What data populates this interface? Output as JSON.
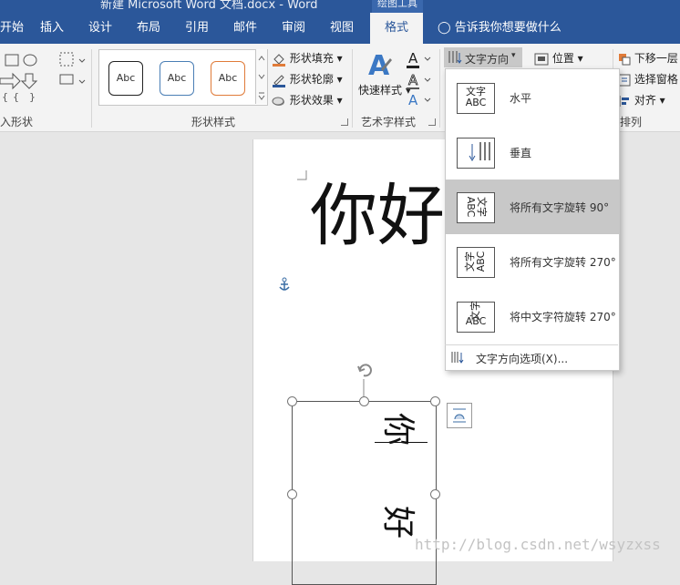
{
  "window": {
    "title": "新建 Microsoft Word 文档.docx - Word",
    "contextual_tab_header": "绘图工具"
  },
  "tabs": [
    "开始",
    "插入",
    "设计",
    "布局",
    "引用",
    "邮件",
    "审阅",
    "视图",
    "格式"
  ],
  "active_tab": "格式",
  "tell_me": "告诉我你想要做什么",
  "ribbon": {
    "insert_shapes_label": "入形状",
    "shape_styles": {
      "label": "形状样式",
      "thumb_text": "Abc",
      "fill": "形状填充",
      "outline": "形状轮廓",
      "effects": "形状效果"
    },
    "wordart": {
      "label": "艺术字样式",
      "quick_styles": "快速样式"
    },
    "text_direction_button": "文字方向",
    "position_button": "位置",
    "arrange": {
      "label": "排列",
      "send_backward": "下移一层",
      "selection_pane": "选择窗格",
      "align": "对齐"
    }
  },
  "text_direction_menu": {
    "items": [
      {
        "label": "水平",
        "selected": false
      },
      {
        "label": "垂直",
        "selected": false
      },
      {
        "label": "将所有文字旋转 90°",
        "selected": true
      },
      {
        "label": "将所有文字旋转 270°",
        "selected": false
      },
      {
        "label": "将中文字符旋转 270°",
        "selected": false
      }
    ],
    "icon_text": {
      "horizontal": [
        "文字",
        "ABC"
      ],
      "rotate90": [
        "文字",
        "ABC"
      ],
      "rotate270": [
        "文字",
        "ABC"
      ],
      "cjk270": [
        "文字",
        "ABC"
      ]
    },
    "options": "文字方向选项(X)..."
  },
  "document": {
    "heading": "你好",
    "textbox_chars": [
      "你",
      "好"
    ]
  },
  "watermark": "http://blog.csdn.net/wsyzxss",
  "colors": {
    "brand_blue": "#2b579a",
    "ribbon_bg": "#f3f3f3",
    "menu_selected": "#c8c8c8",
    "style_outline_black": "#222222",
    "style_outline_blue": "#4a7eb5",
    "style_outline_orange": "#e07b39"
  }
}
